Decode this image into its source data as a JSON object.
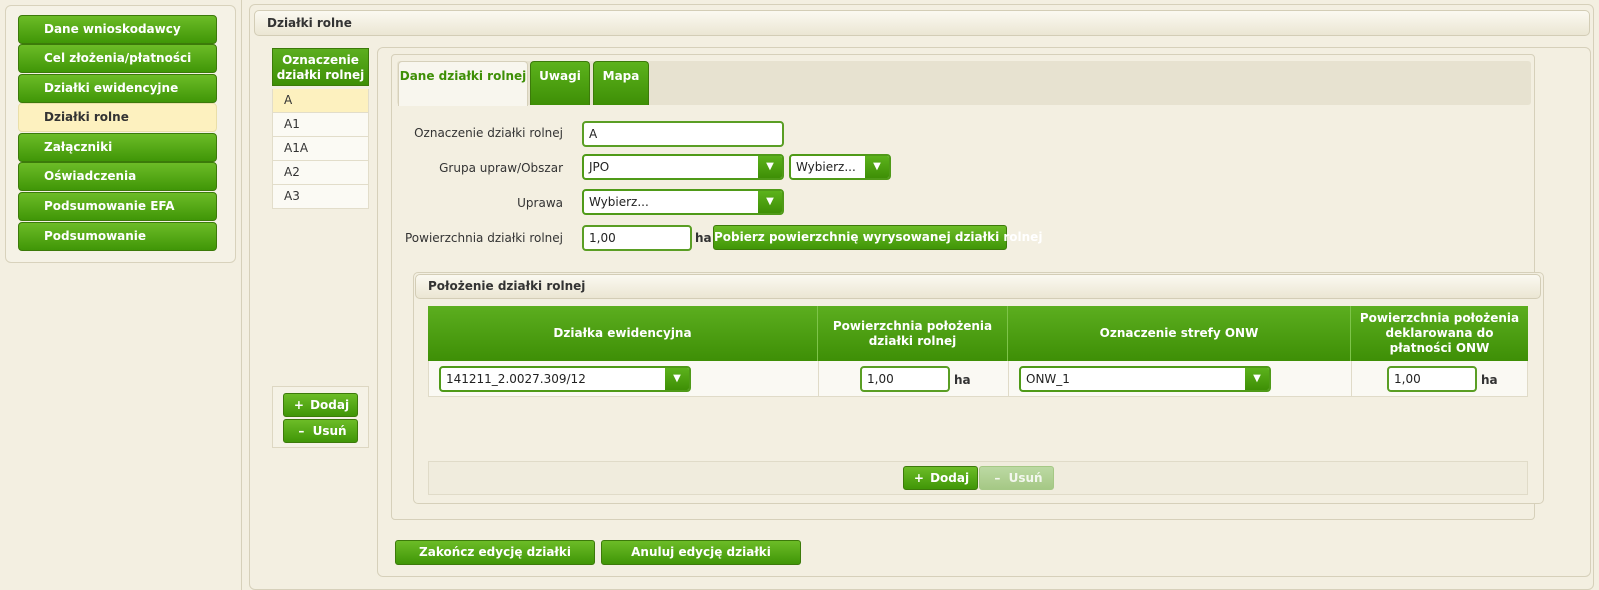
{
  "sidebar": {
    "items": [
      {
        "label": "Dane wnioskodawcy"
      },
      {
        "label": "Cel złożenia/płatności"
      },
      {
        "label": "Działki ewidencyjne"
      },
      {
        "label": "Działki rolne"
      },
      {
        "label": "Załączniki"
      },
      {
        "label": "Oświadczenia"
      },
      {
        "label": "Podsumowanie EFA"
      },
      {
        "label": "Podsumowanie"
      }
    ],
    "active_index": 3
  },
  "main": {
    "title": "Działki rolne"
  },
  "parcel_list": {
    "header": "Oznaczenie działki rolnej",
    "items": [
      "A",
      "A1",
      "A1A",
      "A2",
      "A3"
    ],
    "selected_index": 0,
    "add_label": "Dodaj",
    "remove_label": "Usuń"
  },
  "tabs": [
    {
      "label": "Dane działki rolnej",
      "active": true
    },
    {
      "label": "Uwagi",
      "active": false
    },
    {
      "label": "Mapa",
      "active": false
    }
  ],
  "form": {
    "oznaczenie_label": "Oznaczenie działki rolnej",
    "oznaczenie_value": "A",
    "grupa_label": "Grupa upraw/Obszar",
    "grupa_value": "JPO",
    "obszar_value": "Wybierz...",
    "uprawa_label": "Uprawa",
    "uprawa_value": "Wybierz...",
    "powierzchnia_label": "Powierzchnia działki rolnej",
    "powierzchnia_value": "1,00",
    "unit": "ha",
    "pobierz_label": "Pobierz powierzchnię wyrysowanej działki rolnej"
  },
  "location": {
    "title": "Położenie działki rolnej",
    "columns": [
      "Działka ewidencyjna",
      "Powierzchnia położenia działki rolnej",
      "Oznaczenie strefy ONW",
      "Powierzchnia położenia deklarowana do płatności ONW"
    ],
    "rows": [
      {
        "dzialka": "141211_2.0027.309/12",
        "powierzchnia": "1,00",
        "strefa": "ONW_1",
        "powierzchnia_onw": "1,00"
      }
    ],
    "unit": "ha",
    "add_label": "Dodaj",
    "remove_label": "Usuń"
  },
  "actions": {
    "finish_label": "Zakończ edycję działki",
    "cancel_label": "Anuluj edycję działki"
  },
  "colors": {
    "accent": "#409607",
    "active_bg": "#fdf1bf",
    "page_bg": "#f3efe1"
  }
}
